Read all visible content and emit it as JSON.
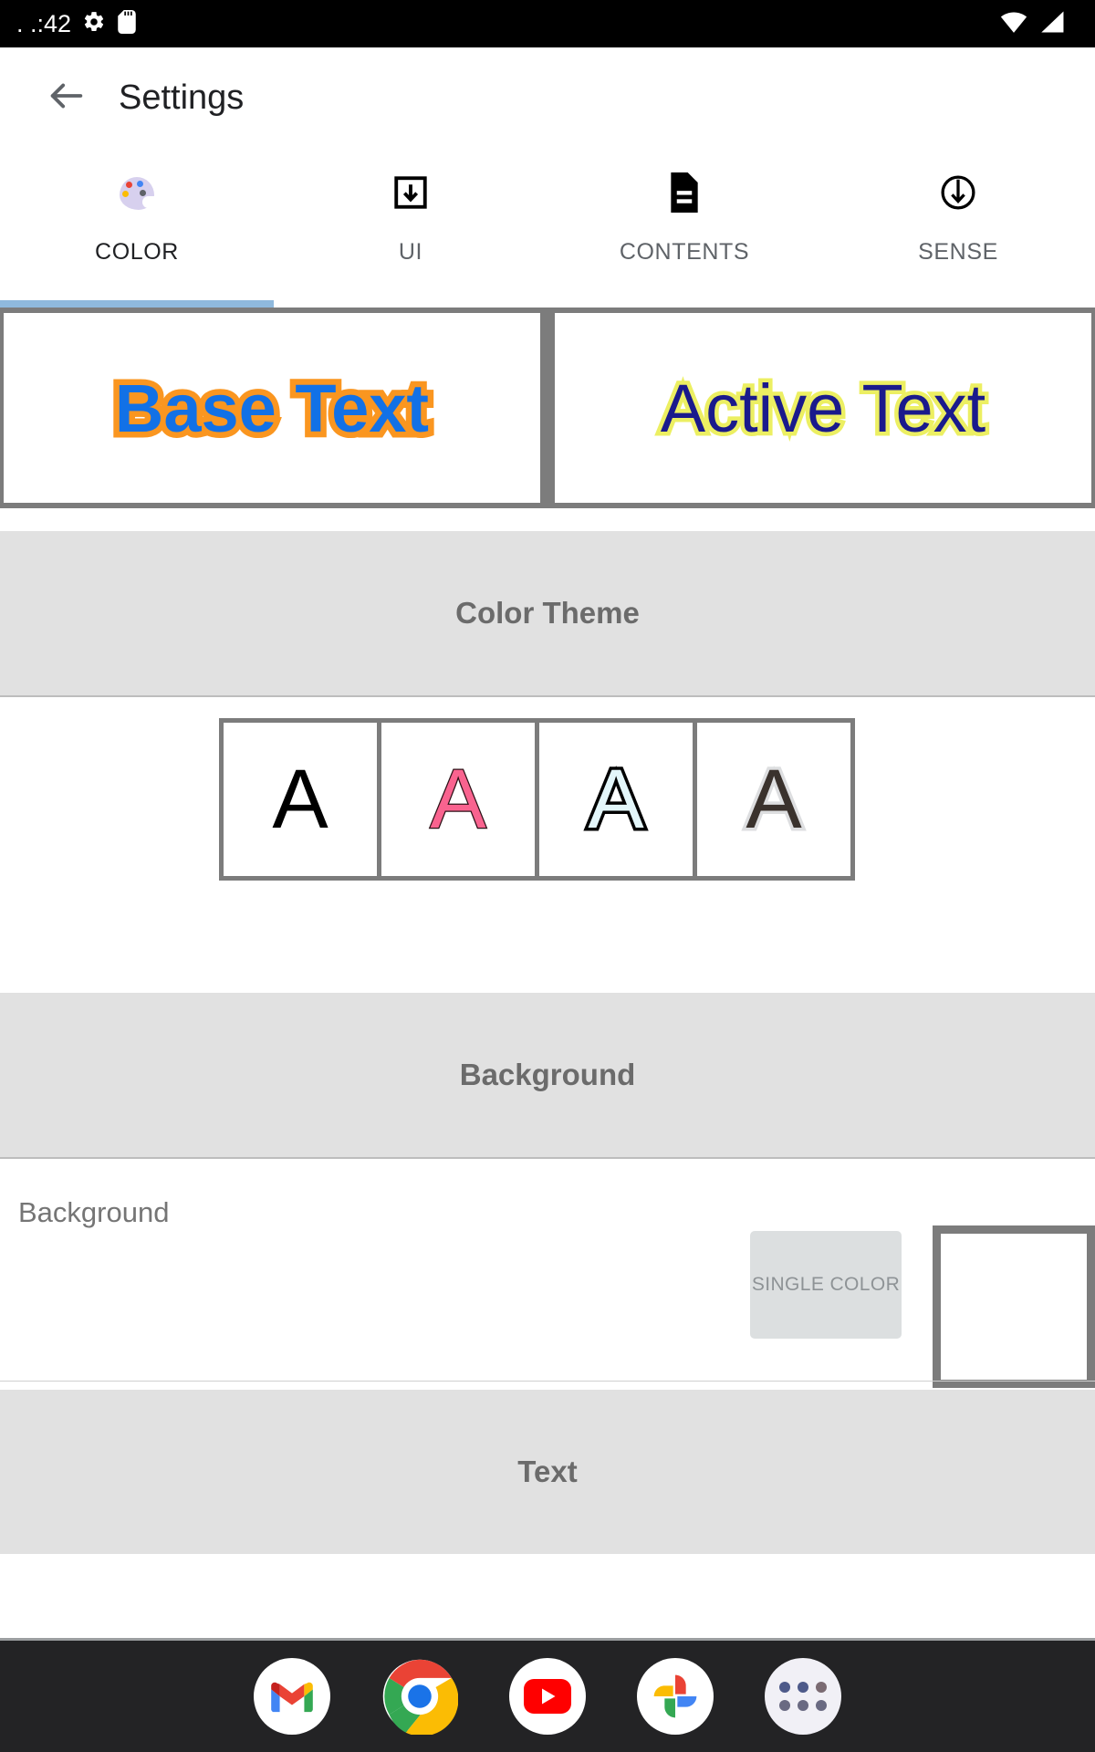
{
  "status_bar": {
    "clock": ". .:42",
    "left_icons": [
      "gear-icon",
      "sd-card-icon"
    ],
    "right_icons": [
      "wifi-icon",
      "cell-signal-icon"
    ],
    "background": "#000000"
  },
  "app_bar": {
    "back_label": "←",
    "title": "Settings"
  },
  "tabs": {
    "active_index": 0,
    "indicator_color": "#8fb9dd",
    "items": [
      {
        "label": "COLOR",
        "icon": "palette-icon"
      },
      {
        "label": "UI",
        "icon": "import-box-icon"
      },
      {
        "label": "CONTENTS",
        "icon": "document-icon"
      },
      {
        "label": "SENSE",
        "icon": "circle-down-arrow-icon"
      }
    ]
  },
  "preview": {
    "base": {
      "text": "Base Text",
      "fill_color": "#1271e6",
      "outline_color": "#FA9620"
    },
    "active": {
      "text": "Active Text",
      "fill_color": "#1a1a8c",
      "outline_color": "#ecef62"
    },
    "frame_color": "#7c7c7c"
  },
  "sections": {
    "color_theme": {
      "title": "Color Theme"
    },
    "background": {
      "title": "Background"
    },
    "text": {
      "title": "Text"
    }
  },
  "color_theme": {
    "swatches": [
      {
        "glyph": "A",
        "fill": "#000000",
        "stroke": "none",
        "name": "theme-black"
      },
      {
        "glyph": "A",
        "fill": "#f9638f",
        "stroke": "#2b1016",
        "name": "theme-pink"
      },
      {
        "glyph": "A",
        "fill": "#e3f6fa",
        "stroke": "#000000",
        "name": "theme-cyan-outline"
      },
      {
        "glyph": "A",
        "fill": "#3a322d",
        "stroke": "#dddee0",
        "name": "theme-brown-glow"
      }
    ]
  },
  "background_row": {
    "label": "Background",
    "mode_button": "SINGLE COLOR",
    "swatch_color": "#ffffff",
    "swatch_border": "#7c7c7c"
  },
  "dock": {
    "background": "#232325",
    "items": [
      {
        "name": "gmail-icon",
        "label": "Gmail"
      },
      {
        "name": "chrome-icon",
        "label": "Chrome"
      },
      {
        "name": "youtube-icon",
        "label": "YouTube"
      },
      {
        "name": "photos-icon",
        "label": "Photos"
      },
      {
        "name": "app-drawer-icon",
        "label": "All apps"
      }
    ]
  }
}
